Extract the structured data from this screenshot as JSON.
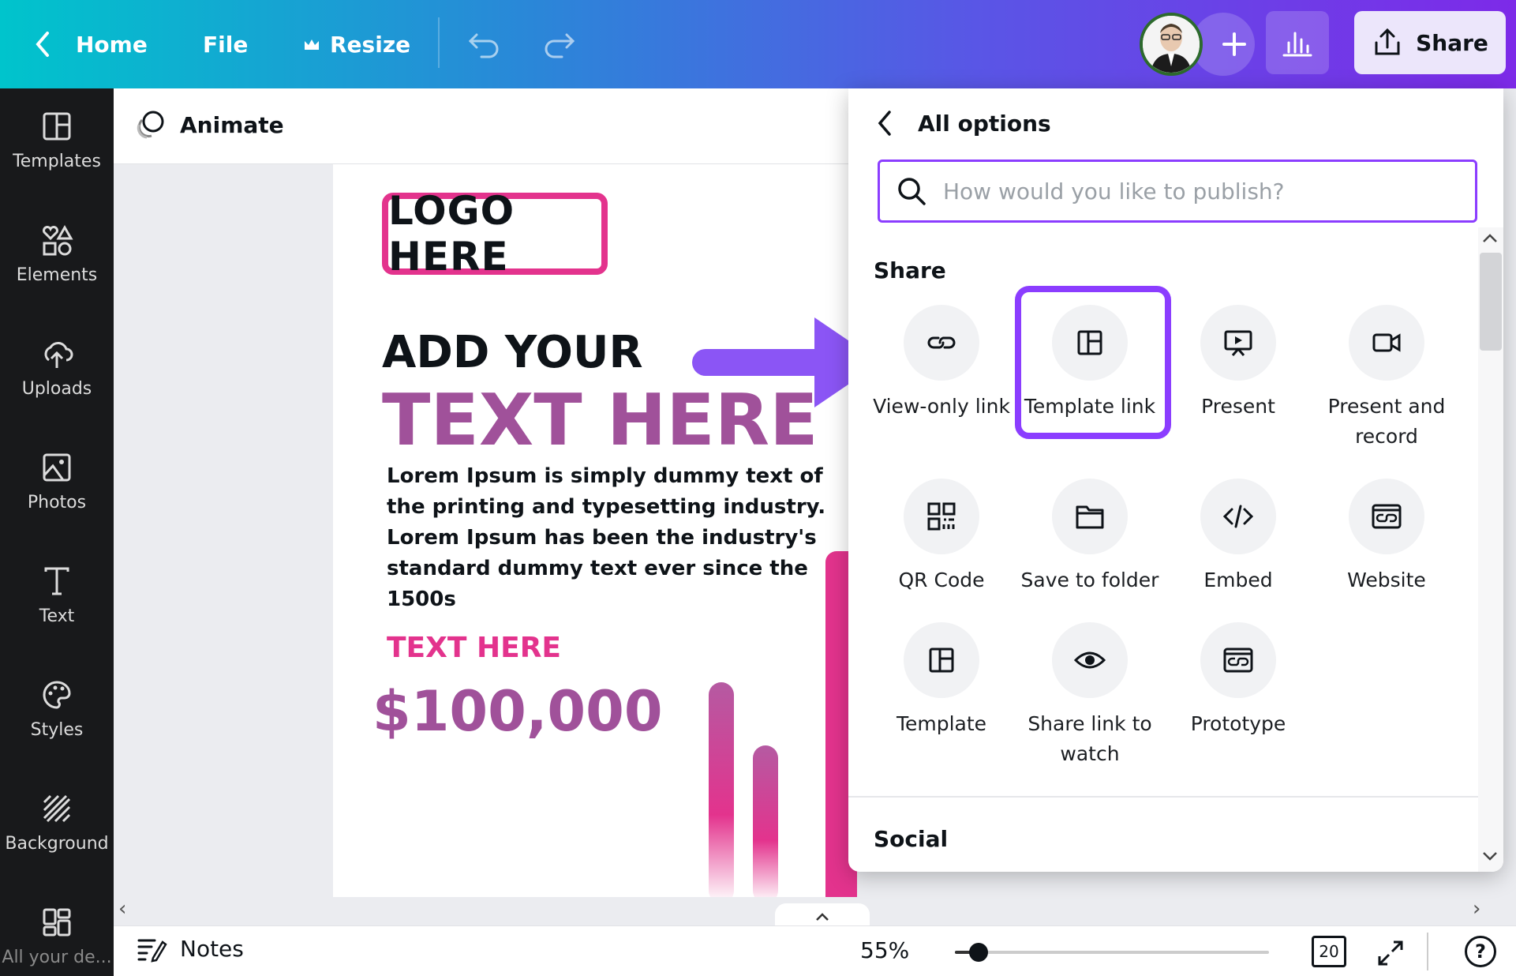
{
  "topbar": {
    "home_label": "Home",
    "file_label": "File",
    "resize_label": "Resize",
    "share_label": "Share"
  },
  "sidebar": {
    "items": [
      {
        "label": "Templates",
        "icon": "templates-icon"
      },
      {
        "label": "Elements",
        "icon": "elements-icon"
      },
      {
        "label": "Uploads",
        "icon": "upload-icon"
      },
      {
        "label": "Photos",
        "icon": "photos-icon"
      },
      {
        "label": "Text",
        "icon": "text-icon"
      },
      {
        "label": "Styles",
        "icon": "palette-icon"
      },
      {
        "label": "Background",
        "icon": "background-icon"
      },
      {
        "label": "All your de...",
        "icon": "all-designs-icon"
      }
    ]
  },
  "editor": {
    "animate_label": "Animate"
  },
  "canvas": {
    "logo_text": "LOGO HERE",
    "heading_1": "ADD YOUR",
    "heading_2": "TEXT HERE",
    "body_text": "Lorem Ipsum is simply dummy text of the printing and typesetting industry. Lorem Ipsum has been the industry's standard dummy text ever since the 1500s",
    "subheading": "TEXT HERE",
    "price": "$100,000"
  },
  "panel": {
    "title": "All options",
    "search_placeholder": "How would you like to publish?",
    "share_section": "Share",
    "social_section": "Social",
    "options": [
      {
        "label": "View-only link",
        "icon": "link-icon"
      },
      {
        "label": "Template link",
        "icon": "template-icon"
      },
      {
        "label": "Present",
        "icon": "present-icon"
      },
      {
        "label": "Present and record",
        "icon": "video-camera-icon"
      },
      {
        "label": "QR Code",
        "icon": "qr-code-icon"
      },
      {
        "label": "Save to folder",
        "icon": "folder-icon"
      },
      {
        "label": "Embed",
        "icon": "code-icon"
      },
      {
        "label": "Website",
        "icon": "website-icon"
      },
      {
        "label": "Template",
        "icon": "template-icon"
      },
      {
        "label": "Share link to watch",
        "icon": "eye-icon"
      },
      {
        "label": "Prototype",
        "icon": "prototype-icon"
      }
    ]
  },
  "bottombar": {
    "notes_label": "Notes",
    "zoom": "55%",
    "page_count": "20",
    "help": "?"
  },
  "colors": {
    "accent": "#8b3dff",
    "brand_pink": "#e3338d",
    "brand_purple": "#a0519a"
  }
}
